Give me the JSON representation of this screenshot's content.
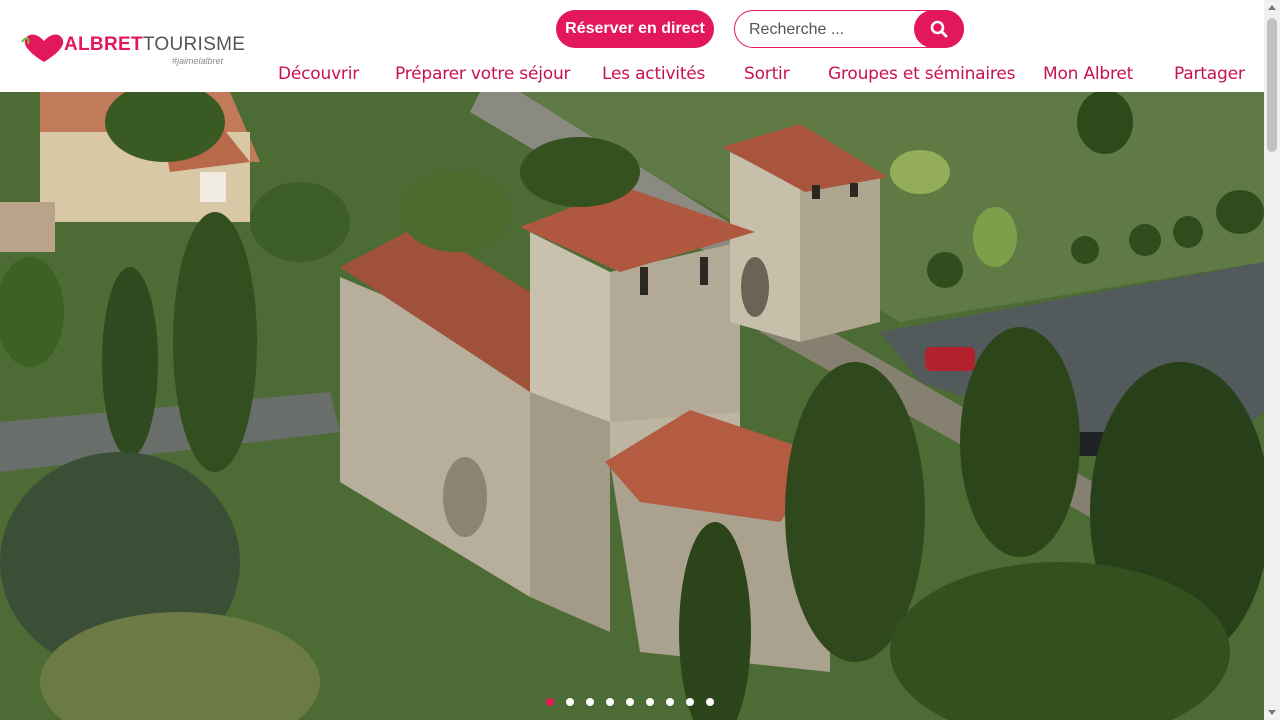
{
  "brand": {
    "name_part1": "ALBRET",
    "name_part2": "TOURISME",
    "tagline": "#jaimelalbret",
    "accent_color": "#e2175c"
  },
  "header": {
    "reserve_label": "Réserver en direct",
    "search": {
      "placeholder": "Recherche ...",
      "value": "",
      "icon": "search-icon"
    }
  },
  "nav": {
    "items": [
      {
        "label": "Découvrir"
      },
      {
        "label": "Préparer votre séjour"
      },
      {
        "label": "Les activités"
      },
      {
        "label": "Sortir"
      },
      {
        "label": "Groupes et séminaires"
      },
      {
        "label": "Mon Albret"
      },
      {
        "label": "Partager"
      }
    ]
  },
  "hero": {
    "slide_count": 9,
    "active_slide": 1
  }
}
